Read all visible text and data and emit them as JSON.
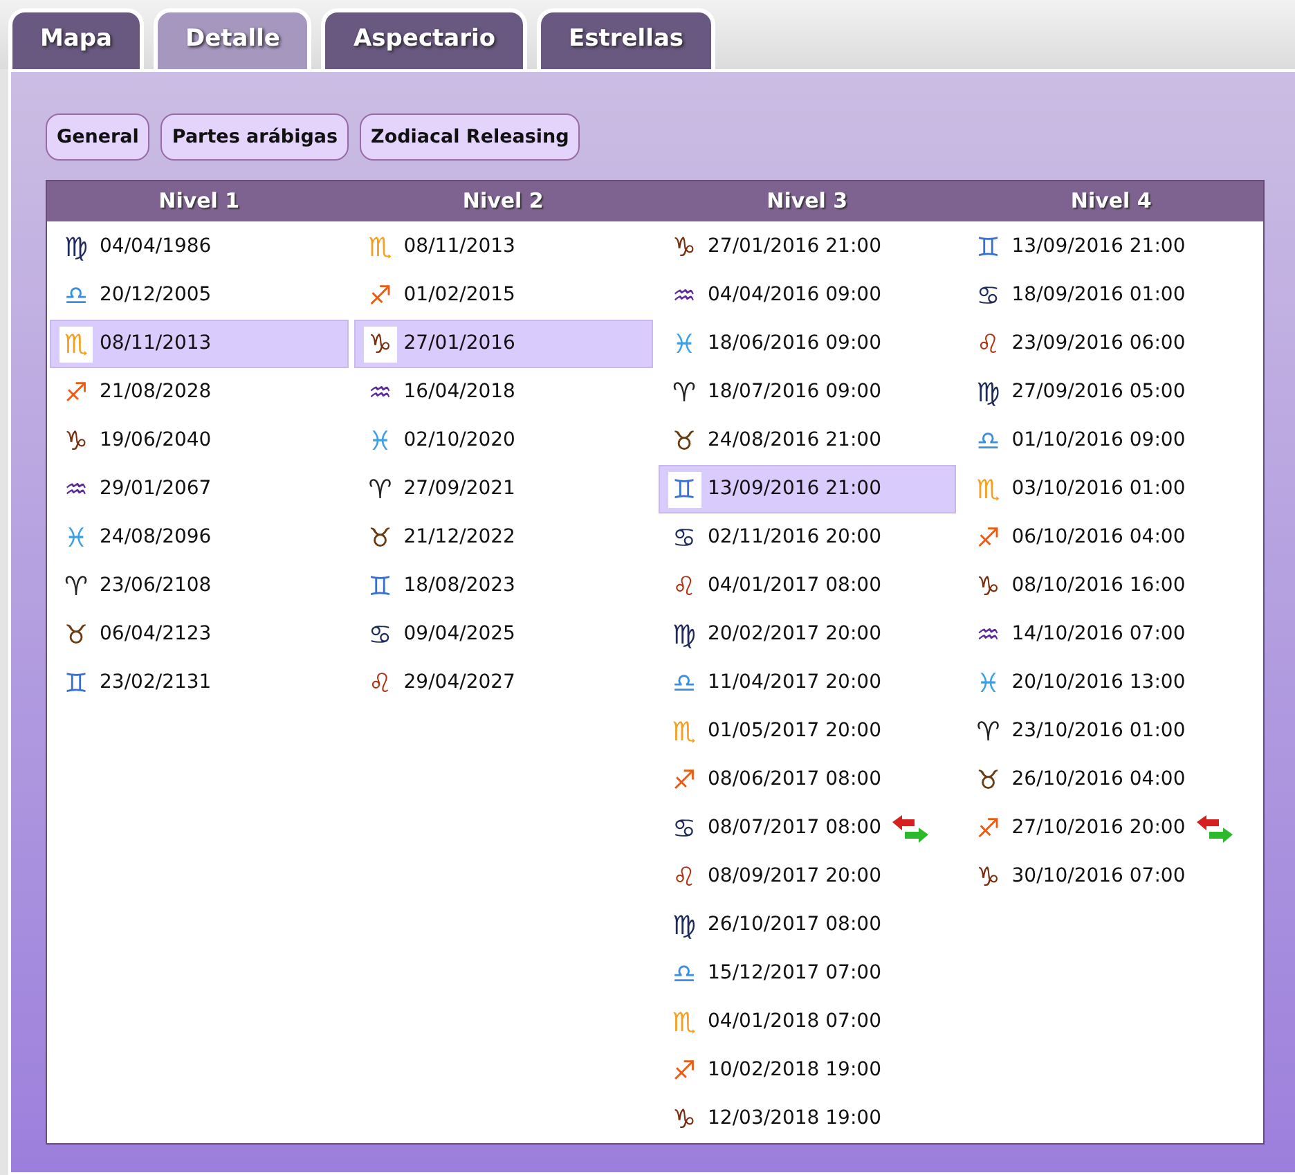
{
  "tabs": [
    {
      "label": "Mapa",
      "selected": false
    },
    {
      "label": "Detalle",
      "selected": true
    },
    {
      "label": "Aspectario",
      "selected": false
    },
    {
      "label": "Estrellas",
      "selected": false
    }
  ],
  "buttons": [
    "General",
    "Partes arábigas",
    "Zodiacal Releasing"
  ],
  "levels": [
    {
      "title": "Nivel 1",
      "rows": [
        {
          "sign": "♍",
          "color": "#1f2a5c",
          "date": "04/04/1986",
          "selected": false,
          "swap": false
        },
        {
          "sign": "♎",
          "color": "#3a8fe0",
          "date": "20/12/2005",
          "selected": false,
          "swap": false
        },
        {
          "sign": "♏",
          "color": "#f5a020",
          "date": "08/11/2013",
          "selected": true,
          "swap": false
        },
        {
          "sign": "♐",
          "color": "#f05a10",
          "date": "21/08/2028",
          "selected": false,
          "swap": false
        },
        {
          "sign": "♑",
          "color": "#7a2e10",
          "date": "19/06/2040",
          "selected": false,
          "swap": false
        },
        {
          "sign": "♒",
          "color": "#5a2a9a",
          "date": "29/01/2067",
          "selected": false,
          "swap": false
        },
        {
          "sign": "♓",
          "color": "#3aa0e8",
          "date": "24/08/2096",
          "selected": false,
          "swap": false
        },
        {
          "sign": "♈",
          "color": "#222222",
          "date": "23/06/2108",
          "selected": false,
          "swap": false
        },
        {
          "sign": "♉",
          "color": "#6a3a10",
          "date": "06/04/2123",
          "selected": false,
          "swap": false
        },
        {
          "sign": "♊",
          "color": "#3a70d0",
          "date": "23/02/2131",
          "selected": false,
          "swap": false
        }
      ]
    },
    {
      "title": "Nivel 2",
      "rows": [
        {
          "sign": "♏",
          "color": "#f5a020",
          "date": "08/11/2013",
          "selected": false,
          "swap": false
        },
        {
          "sign": "♐",
          "color": "#f05a10",
          "date": "01/02/2015",
          "selected": false,
          "swap": false
        },
        {
          "sign": "♑",
          "color": "#7a2e10",
          "date": "27/01/2016",
          "selected": true,
          "swap": false
        },
        {
          "sign": "♒",
          "color": "#5a2a9a",
          "date": "16/04/2018",
          "selected": false,
          "swap": false
        },
        {
          "sign": "♓",
          "color": "#3aa0e8",
          "date": "02/10/2020",
          "selected": false,
          "swap": false
        },
        {
          "sign": "♈",
          "color": "#222222",
          "date": "27/09/2021",
          "selected": false,
          "swap": false
        },
        {
          "sign": "♉",
          "color": "#6a3a10",
          "date": "21/12/2022",
          "selected": false,
          "swap": false
        },
        {
          "sign": "♊",
          "color": "#3a70d0",
          "date": "18/08/2023",
          "selected": false,
          "swap": false
        },
        {
          "sign": "♋",
          "color": "#1f2a5c",
          "date": "09/04/2025",
          "selected": false,
          "swap": false
        },
        {
          "sign": "♌",
          "color": "#b03010",
          "date": "29/04/2027",
          "selected": false,
          "swap": false
        }
      ]
    },
    {
      "title": "Nivel 3",
      "rows": [
        {
          "sign": "♑",
          "color": "#7a2e10",
          "date": "27/01/2016 21:00",
          "selected": false,
          "swap": false
        },
        {
          "sign": "♒",
          "color": "#5a2a9a",
          "date": "04/04/2016 09:00",
          "selected": false,
          "swap": false
        },
        {
          "sign": "♓",
          "color": "#3aa0e8",
          "date": "18/06/2016 09:00",
          "selected": false,
          "swap": false
        },
        {
          "sign": "♈",
          "color": "#222222",
          "date": "18/07/2016 09:00",
          "selected": false,
          "swap": false
        },
        {
          "sign": "♉",
          "color": "#6a3a10",
          "date": "24/08/2016 21:00",
          "selected": false,
          "swap": false
        },
        {
          "sign": "♊",
          "color": "#3a70d0",
          "date": "13/09/2016 21:00",
          "selected": true,
          "swap": false
        },
        {
          "sign": "♋",
          "color": "#1f2a5c",
          "date": "02/11/2016 20:00",
          "selected": false,
          "swap": false
        },
        {
          "sign": "♌",
          "color": "#b03010",
          "date": "04/01/2017 08:00",
          "selected": false,
          "swap": false
        },
        {
          "sign": "♍",
          "color": "#1f2a5c",
          "date": "20/02/2017 20:00",
          "selected": false,
          "swap": false
        },
        {
          "sign": "♎",
          "color": "#3a8fe0",
          "date": "11/04/2017 20:00",
          "selected": false,
          "swap": false
        },
        {
          "sign": "♏",
          "color": "#f5a020",
          "date": "01/05/2017 20:00",
          "selected": false,
          "swap": false
        },
        {
          "sign": "♐",
          "color": "#f05a10",
          "date": "08/06/2017 08:00",
          "selected": false,
          "swap": false
        },
        {
          "sign": "♋",
          "color": "#1f2a5c",
          "date": "08/07/2017 08:00",
          "selected": false,
          "swap": true
        },
        {
          "sign": "♌",
          "color": "#b03010",
          "date": "08/09/2017 20:00",
          "selected": false,
          "swap": false
        },
        {
          "sign": "♍",
          "color": "#1f2a5c",
          "date": "26/10/2017 08:00",
          "selected": false,
          "swap": false
        },
        {
          "sign": "♎",
          "color": "#3a8fe0",
          "date": "15/12/2017 07:00",
          "selected": false,
          "swap": false
        },
        {
          "sign": "♏",
          "color": "#f5a020",
          "date": "04/01/2018 07:00",
          "selected": false,
          "swap": false
        },
        {
          "sign": "♐",
          "color": "#f05a10",
          "date": "10/02/2018 19:00",
          "selected": false,
          "swap": false
        },
        {
          "sign": "♑",
          "color": "#7a2e10",
          "date": "12/03/2018 19:00",
          "selected": false,
          "swap": false
        }
      ]
    },
    {
      "title": "Nivel 4",
      "rows": [
        {
          "sign": "♊",
          "color": "#3a70d0",
          "date": "13/09/2016 21:00",
          "selected": false,
          "swap": false
        },
        {
          "sign": "♋",
          "color": "#1f2a5c",
          "date": "18/09/2016 01:00",
          "selected": false,
          "swap": false
        },
        {
          "sign": "♌",
          "color": "#b03010",
          "date": "23/09/2016 06:00",
          "selected": false,
          "swap": false
        },
        {
          "sign": "♍",
          "color": "#1f2a5c",
          "date": "27/09/2016 05:00",
          "selected": false,
          "swap": false
        },
        {
          "sign": "♎",
          "color": "#3a8fe0",
          "date": "01/10/2016 09:00",
          "selected": false,
          "swap": false
        },
        {
          "sign": "♏",
          "color": "#f5a020",
          "date": "03/10/2016 01:00",
          "selected": false,
          "swap": false
        },
        {
          "sign": "♐",
          "color": "#f05a10",
          "date": "06/10/2016 04:00",
          "selected": false,
          "swap": false
        },
        {
          "sign": "♑",
          "color": "#7a2e10",
          "date": "08/10/2016 16:00",
          "selected": false,
          "swap": false
        },
        {
          "sign": "♒",
          "color": "#5a2a9a",
          "date": "14/10/2016 07:00",
          "selected": false,
          "swap": false
        },
        {
          "sign": "♓",
          "color": "#3aa0e8",
          "date": "20/10/2016 13:00",
          "selected": false,
          "swap": false
        },
        {
          "sign": "♈",
          "color": "#222222",
          "date": "23/10/2016 01:00",
          "selected": false,
          "swap": false
        },
        {
          "sign": "♉",
          "color": "#6a3a10",
          "date": "26/10/2016 04:00",
          "selected": false,
          "swap": false
        },
        {
          "sign": "♐",
          "color": "#f05a10",
          "date": "27/10/2016 20:00",
          "selected": false,
          "swap": true
        },
        {
          "sign": "♑",
          "color": "#7a2e10",
          "date": "30/10/2016 07:00",
          "selected": false,
          "swap": false
        }
      ]
    }
  ]
}
